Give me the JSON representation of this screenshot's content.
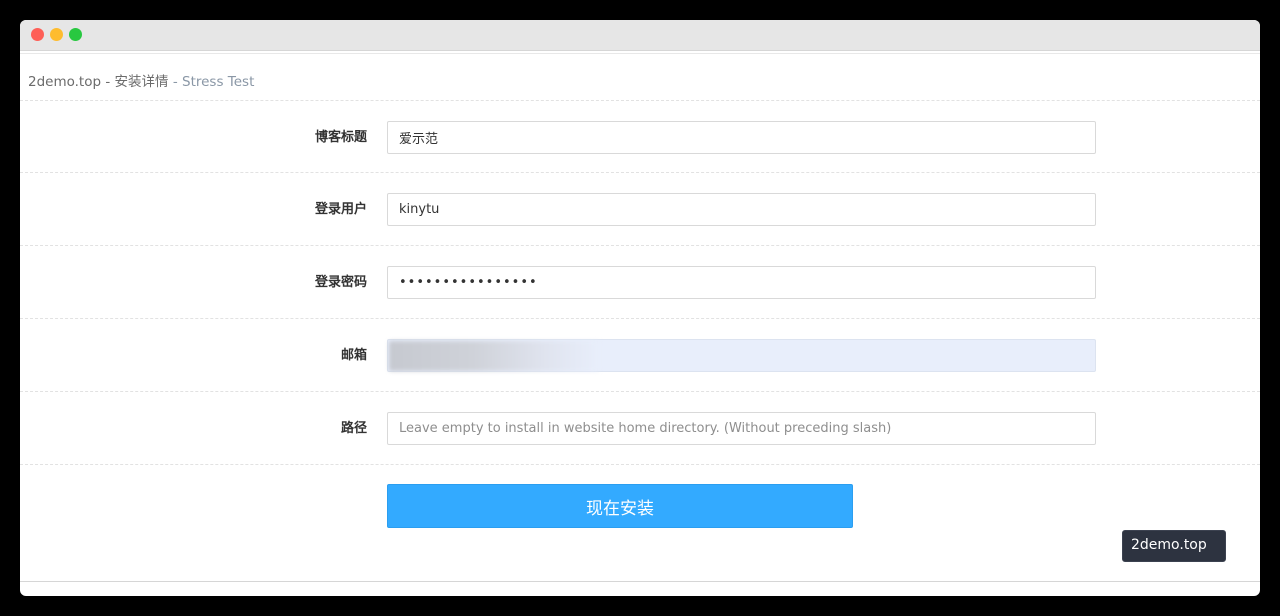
{
  "page": {
    "title_site": "2demo.top",
    "title_sep1": " - ",
    "title_main": "安装详情",
    "title_sep2": " - ",
    "title_app": "Stress Test"
  },
  "form": {
    "blog_title": {
      "label": "博客标题",
      "value": "爱示范"
    },
    "login_user": {
      "label": "登录用户",
      "value": "kinytu"
    },
    "login_password": {
      "label": "登录密码",
      "value": "••••••••••••••••"
    },
    "email": {
      "label": "邮箱",
      "value": ""
    },
    "path": {
      "label": "路径",
      "value": "",
      "placeholder": "Leave empty to install in website home directory. (Without preceding slash)"
    },
    "submit_label": "现在安装"
  },
  "watermark": {
    "text": "2demo.top"
  },
  "colors": {
    "accent": "#33aaff",
    "watermark_bg": "#2d3340",
    "email_autofill_bg": "#e8eefb"
  }
}
